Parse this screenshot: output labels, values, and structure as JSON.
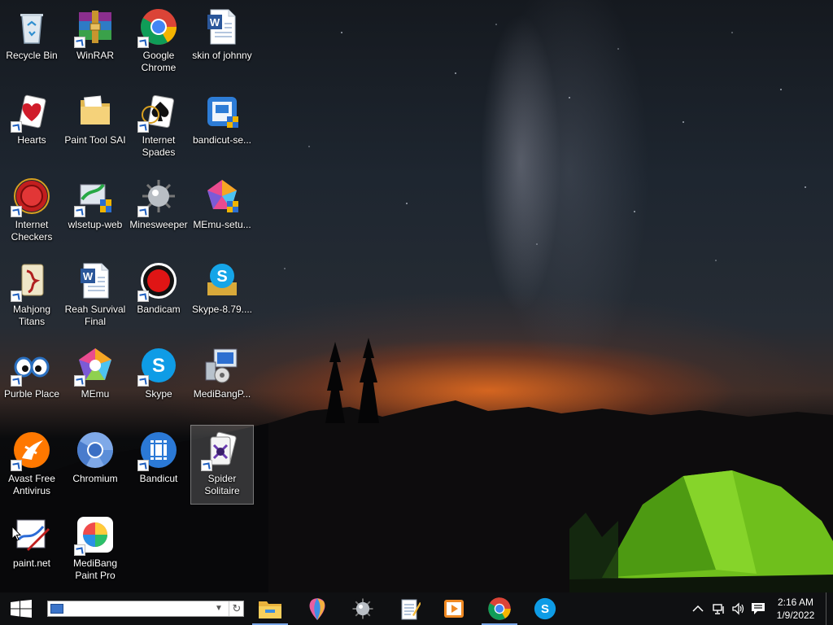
{
  "desktop": {
    "icons": [
      {
        "label": "Recycle Bin",
        "icon": "recycle-bin-icon",
        "shortcut": false
      },
      {
        "label": "WinRAR",
        "icon": "winrar-icon",
        "shortcut": true
      },
      {
        "label": "Google Chrome",
        "icon": "google-chrome-icon",
        "shortcut": true
      },
      {
        "label": "skin of johnny",
        "icon": "word-document-icon",
        "shortcut": false
      },
      {
        "label": "Hearts",
        "icon": "hearts-icon",
        "shortcut": true
      },
      {
        "label": "Paint Tool SAI",
        "icon": "folder-icon",
        "shortcut": false
      },
      {
        "label": "Internet Spades",
        "icon": "internet-spades-icon",
        "shortcut": true
      },
      {
        "label": "bandicut-se...",
        "icon": "installer-icon",
        "shortcut": false
      },
      {
        "label": "Internet Checkers",
        "icon": "internet-checkers-icon",
        "shortcut": true
      },
      {
        "label": "wlsetup-web",
        "icon": "wlsetup-icon",
        "shortcut": true
      },
      {
        "label": "Minesweeper",
        "icon": "minesweeper-icon",
        "shortcut": true
      },
      {
        "label": "MEmu-setu...",
        "icon": "memu-setup-icon",
        "shortcut": false
      },
      {
        "label": "Mahjong Titans",
        "icon": "mahjong-icon",
        "shortcut": true
      },
      {
        "label": "Reah Survival Final",
        "icon": "word-document-icon",
        "shortcut": false
      },
      {
        "label": "Bandicam",
        "icon": "bandicam-icon",
        "shortcut": true
      },
      {
        "label": "Skype-8.79....",
        "icon": "skype-setup-icon",
        "shortcut": false
      },
      {
        "label": "Purble Place",
        "icon": "purble-place-icon",
        "shortcut": true
      },
      {
        "label": "MEmu",
        "icon": "memu-icon",
        "shortcut": true
      },
      {
        "label": "Skype",
        "icon": "skype-icon",
        "shortcut": true
      },
      {
        "label": "MediBangP...",
        "icon": "medibang-setup-icon",
        "shortcut": false
      },
      {
        "label": "Avast Free Antivirus",
        "icon": "avast-icon",
        "shortcut": true
      },
      {
        "label": "Chromium",
        "icon": "chromium-icon",
        "shortcut": false
      },
      {
        "label": "Bandicut",
        "icon": "bandicut-icon",
        "shortcut": true
      },
      {
        "label": "Spider Solitaire",
        "icon": "spider-solitaire-icon",
        "shortcut": true
      },
      {
        "label": "paint.net",
        "icon": "paint-net-icon",
        "shortcut": false
      },
      {
        "label": "MediBang Paint Pro",
        "icon": "medibang-icon",
        "shortcut": true
      }
    ],
    "selected_label": "Spider Solitaire"
  },
  "taskbar": {
    "search_value": "",
    "pinned": [
      {
        "name": "File Explorer",
        "icon": "file-explorer-icon",
        "open": true
      },
      {
        "name": "Paint 3D",
        "icon": "paint-3d-icon",
        "open": false
      },
      {
        "name": "Minesweeper",
        "icon": "minesweeper-icon",
        "open": false
      },
      {
        "name": "Notepad",
        "icon": "notepad-icon",
        "open": false
      },
      {
        "name": "Media Player",
        "icon": "media-player-icon",
        "open": false
      },
      {
        "name": "Google Chrome",
        "icon": "google-chrome-icon",
        "open": true
      },
      {
        "name": "Skype",
        "icon": "skype-icon",
        "open": false
      }
    ],
    "tray": {
      "time": "2:16 AM",
      "date": "1/9/2022"
    }
  },
  "colors": {
    "taskbar": "#0f1012",
    "accent": "#7aa7e8"
  }
}
